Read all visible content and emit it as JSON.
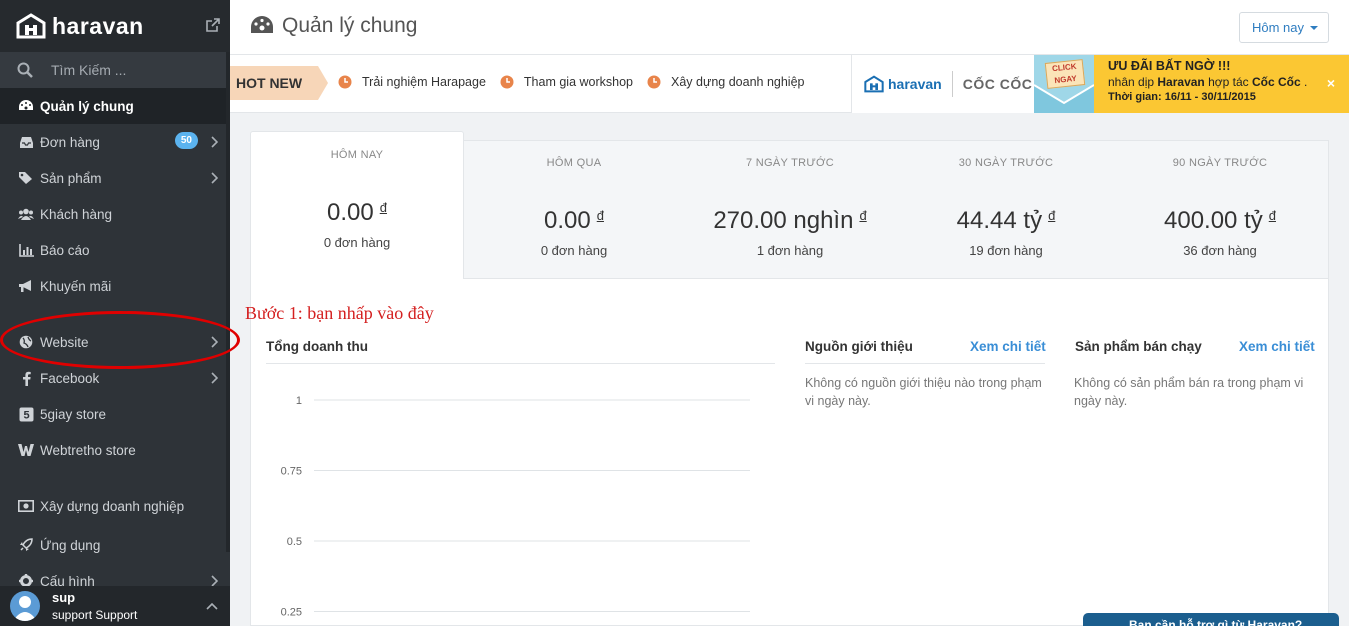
{
  "brand": {
    "name": "haravan"
  },
  "search": {
    "label": "Tìm Kiếm ..."
  },
  "sidebar": {
    "items": [
      {
        "label": "Quản lý chung",
        "icon": "dashboard-icon"
      },
      {
        "label": "Đơn hàng",
        "icon": "inbox-icon",
        "badge": "50"
      },
      {
        "label": "Sản phẩm",
        "icon": "tags-icon"
      },
      {
        "label": "Khách hàng",
        "icon": "users-icon"
      },
      {
        "label": "Báo cáo",
        "icon": "bar-chart-icon"
      },
      {
        "label": "Khuyến mãi",
        "icon": "bullhorn-icon"
      },
      {
        "label": "Website",
        "icon": "globe-icon"
      },
      {
        "label": "Facebook",
        "icon": "facebook-icon"
      },
      {
        "label": "5giay store",
        "icon": "5giay-icon"
      },
      {
        "label": "Webtretho store",
        "icon": "webtretho-icon"
      },
      {
        "label": "Xây dựng doanh nghiệp",
        "icon": "money-icon"
      },
      {
        "label": "Ứng dụng",
        "icon": "rocket-icon"
      },
      {
        "label": "Cấu hình",
        "icon": "gear-icon"
      }
    ]
  },
  "user": {
    "name": "sup",
    "role": "support Support"
  },
  "header": {
    "title": "Quản lý chung",
    "date_filter": "Hôm nay"
  },
  "hotnew": {
    "tag": "HOT NEW",
    "links": [
      "Trải nghiệm Harapage",
      "Tham gia workshop",
      "Xây dựng doanh nghiệp"
    ]
  },
  "promo": {
    "haravan": "haravan",
    "coccoc": "CỐC CỐC",
    "click_card": "CLICK NGAY",
    "headline": "ƯU ĐÃI BẤT NGỜ !!!",
    "sub_prefix": "nhân dịp",
    "sub_brand1": "Haravan",
    "sub_mid": "hợp tác",
    "sub_brand2": "Cốc Cốc",
    "period": "Thời gian: 16/11 - 30/11/2015",
    "close": "×"
  },
  "stats": [
    {
      "label": "HÔM NAY",
      "value": "0.00",
      "currency": "đ",
      "orders": "0 đơn hàng"
    },
    {
      "label": "HÔM QUA",
      "value": "0.00",
      "currency": "đ",
      "orders": "0 đơn hàng"
    },
    {
      "label": "7 NGÀY TRƯỚC",
      "value": "270.00 nghìn",
      "currency": "đ",
      "orders": "1 đơn hàng"
    },
    {
      "label": "30 NGÀY TRƯỚC",
      "value": "44.44 tỷ",
      "currency": "đ",
      "orders": "19 đơn hàng"
    },
    {
      "label": "90 NGÀY TRƯỚC",
      "value": "400.00 tỷ",
      "currency": "đ",
      "orders": "36 đơn hàng"
    }
  ],
  "annotation": {
    "step1": "Bước 1: bạn nhấp vào đây"
  },
  "revenue": {
    "title": "Tổng doanh thu"
  },
  "chart_data": {
    "type": "line",
    "title": "",
    "ylim": [
      0,
      1
    ],
    "yticks": [
      "1",
      "0.75",
      "0.5",
      "0.25"
    ],
    "series": [],
    "grid": true
  },
  "referrals": {
    "title": "Nguồn giới thiệu",
    "link": "Xem chi tiết",
    "empty": "Không có nguồn giới thiệu nào trong phạm vi ngày này."
  },
  "bestsellers": {
    "title": "Sản phẩm bán chạy",
    "link": "Xem chi tiết",
    "empty": "Không có sản phẩm bán ra trong phạm vi ngày này."
  },
  "help": {
    "label": "Bạn cần hỗ trợ gì từ Haravan?"
  },
  "colors": {
    "sidebar": "#2e3338",
    "accent": "#3a8ed6",
    "annotation": "#d42020",
    "promo": "#fbc733"
  }
}
